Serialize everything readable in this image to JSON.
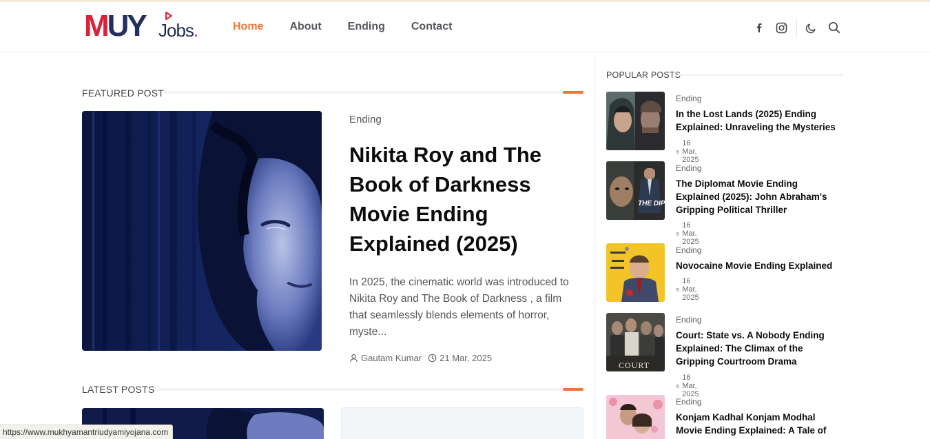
{
  "brand": {
    "logo_main": "MUY",
    "logo_sub": "Jobs",
    "logo_dot": ".",
    "accent_color": "#f07438",
    "logo_red": "#d9213a",
    "logo_navy": "#23305e"
  },
  "nav": {
    "items": [
      {
        "label": "Home",
        "active": true
      },
      {
        "label": "About",
        "active": false
      },
      {
        "label": "Ending",
        "active": false
      },
      {
        "label": "Contact",
        "active": false
      }
    ]
  },
  "header_icons": [
    "facebook-icon",
    "instagram-icon",
    "moon-icon",
    "search-icon"
  ],
  "featured": {
    "section_title": "FEATURED POST",
    "category": "Ending",
    "title": "Nikita Roy and The Book of Darkness Movie Ending Explained (2025)",
    "excerpt": "In 2025, the cinematic world was introduced to Nikita Roy and The Book of Darkness , a film that seamlessly blends elements of horror, myste...",
    "author": "Gautam Kumar",
    "date": "21 Mar, 2025"
  },
  "latest": {
    "section_title": "LATEST POSTS"
  },
  "popular": {
    "section_title": "POPULAR POSTS",
    "items": [
      {
        "category": "Ending",
        "title": "In the Lost Lands (2025) Ending Explained: Unraveling the Mysteries",
        "date": "16 Mar, 2025"
      },
      {
        "category": "Ending",
        "title": "The Diplomat Movie Ending Explained (2025): John Abraham's Gripping Political Thriller",
        "date": "16 Mar, 2025",
        "thumb_text": "THE DIPLO"
      },
      {
        "category": "Ending",
        "title": "Novocaine Movie Ending Explained",
        "date": "16 Mar, 2025"
      },
      {
        "category": "Ending",
        "title": "Court: State vs. A Nobody Ending Explained: The Climax of the Gripping Courtroom Drama",
        "date": "16 Mar, 2025",
        "thumb_text": "COURT"
      },
      {
        "category": "Ending",
        "title": "Konjam Kadhal Konjam Modhal Movie Ending Explained: A Tale of",
        "date": ""
      }
    ]
  },
  "status_bar": {
    "url": "https://www.mukhyamantriudyamiyojana.com"
  }
}
